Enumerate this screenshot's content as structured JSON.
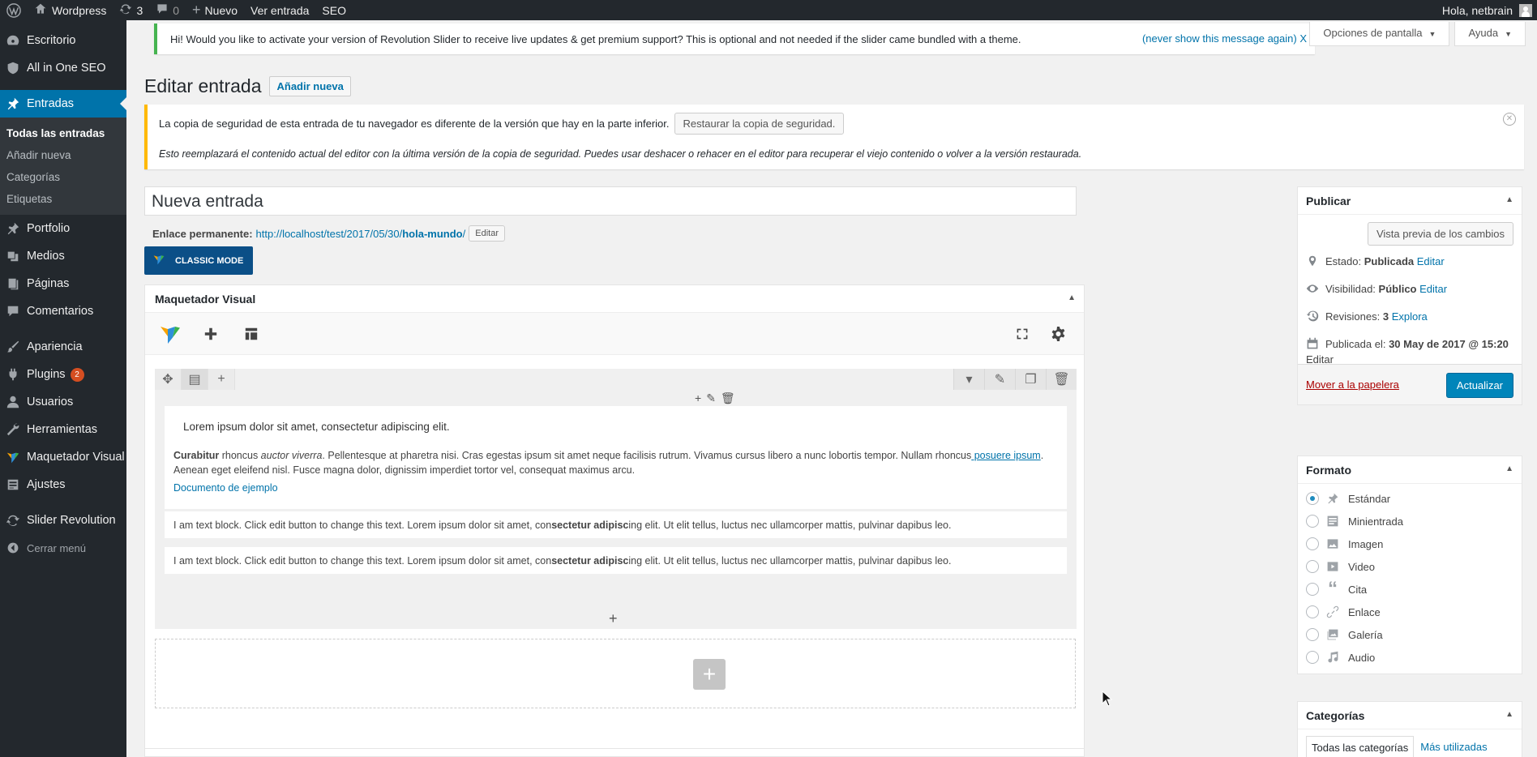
{
  "adminbar": {
    "site_name": "Wordpress",
    "updates_count": "3",
    "comments_count": "0",
    "new_label": "Nuevo",
    "view_post": "Ver entrada",
    "seo": "SEO",
    "greeting": "Hola, netbrain"
  },
  "sidebar": {
    "items": [
      {
        "label": "Escritorio",
        "icon": "dashboard-icon"
      },
      {
        "label": "All in One SEO",
        "icon": "shield-icon"
      },
      {
        "label": "Entradas",
        "icon": "pin-icon"
      },
      {
        "label": "Portfolio",
        "icon": "pin-icon"
      },
      {
        "label": "Medios",
        "icon": "media-icon"
      },
      {
        "label": "Páginas",
        "icon": "pages-icon"
      },
      {
        "label": "Comentarios",
        "icon": "comment-icon"
      },
      {
        "label": "Apariencia",
        "icon": "brush-icon"
      },
      {
        "label": "Plugins",
        "icon": "plug-icon",
        "badge": "2"
      },
      {
        "label": "Usuarios",
        "icon": "user-icon"
      },
      {
        "label": "Herramientas",
        "icon": "wrench-icon"
      },
      {
        "label": "Maquetador Visual",
        "icon": "vc-logo-icon"
      },
      {
        "label": "Ajustes",
        "icon": "settings-icon"
      },
      {
        "label": "Slider Revolution",
        "icon": "refresh-icon"
      }
    ],
    "submenu": [
      "Todas las entradas",
      "Añadir nueva",
      "Categorías",
      "Etiquetas"
    ],
    "collapse": "Cerrar menú"
  },
  "notice": {
    "text": "Hi! Would you like to activate your version of Revolution Slider to receive live updates & get premium support? This is optional and not needed if the slider came bundled with a theme.",
    "link": "(never show this message again)  X"
  },
  "screen_options": "Opciones de pantalla",
  "help": "Ayuda",
  "page": {
    "title": "Editar entrada",
    "add_new": "Añadir nueva"
  },
  "autosave": {
    "line1": "La copia de seguridad de esta entrada de tu navegador es diferente de la versión que hay en la parte inferior.",
    "restore": "Restaurar la copia de seguridad.",
    "line2": "Esto reemplazará el contenido actual del editor con la última versión de la copia de seguridad. Puedes usar deshacer o rehacer en el editor para recuperar el viejo contenido o volver a la versión restaurada."
  },
  "post": {
    "title": "Nueva entrada",
    "permalink_label": "Enlace permanente:",
    "permalink_base": "http://localhost/test/2017/05/30/",
    "permalink_slug": "hola-mundo",
    "edit": "Editar",
    "classic_mode": "CLASSIC MODE"
  },
  "builder": {
    "title": "Maquetador Visual",
    "lorem_heading": "Lorem ipsum dolor sit amet, consectetur adipiscing elit.",
    "para_bold": "Curabitur",
    "para_1": " rhoncus ",
    "para_italic": "auctor viverra",
    "para_2": ". Pellentesque at pharetra nisi. Cras egestas ipsum sit amet neque facilisis rutrum. Vivamus cursus libero a nunc lobortis tempor. Nullam rhoncus",
    "para_link": " posuere ipsum",
    "para_3": ". Aenean eget eleifend nisl. Fusce magna dolor, dignissim imperdiet tortor vel, consequat maximus arcu.",
    "doc_link": "Documento de ejemplo",
    "text_a": "I am text block. Click edit button to change this text. Lorem ipsum dolor sit amet, con",
    "text_b": "sectetur adipisc",
    "text_c": "ing elit. Ut elit tellus, luctus nec ullamcorper mattis, pulvinar dapibus leo."
  },
  "publish": {
    "title": "Publicar",
    "preview": "Vista previa de los cambios",
    "status_label": "Estado:",
    "status_value": "Publicada",
    "visibility_label": "Visibilidad:",
    "visibility_value": "Público",
    "revisions_label": "Revisiones:",
    "revisions_value": "3",
    "revisions_link": "Explora",
    "published_label": "Publicada el:",
    "published_value": "30 May de 2017 @ 15:20",
    "edit": "Editar",
    "trash": "Mover a la papelera",
    "update": "Actualizar"
  },
  "format": {
    "title": "Formato",
    "options": [
      "Estándar",
      "Minientrada",
      "Imagen",
      "Video",
      "Cita",
      "Enlace",
      "Galería",
      "Audio"
    ],
    "selected": "Estándar"
  },
  "categories": {
    "title": "Categorías",
    "tab_all": "Todas las categorías",
    "tab_used": "Más utilizadas"
  }
}
